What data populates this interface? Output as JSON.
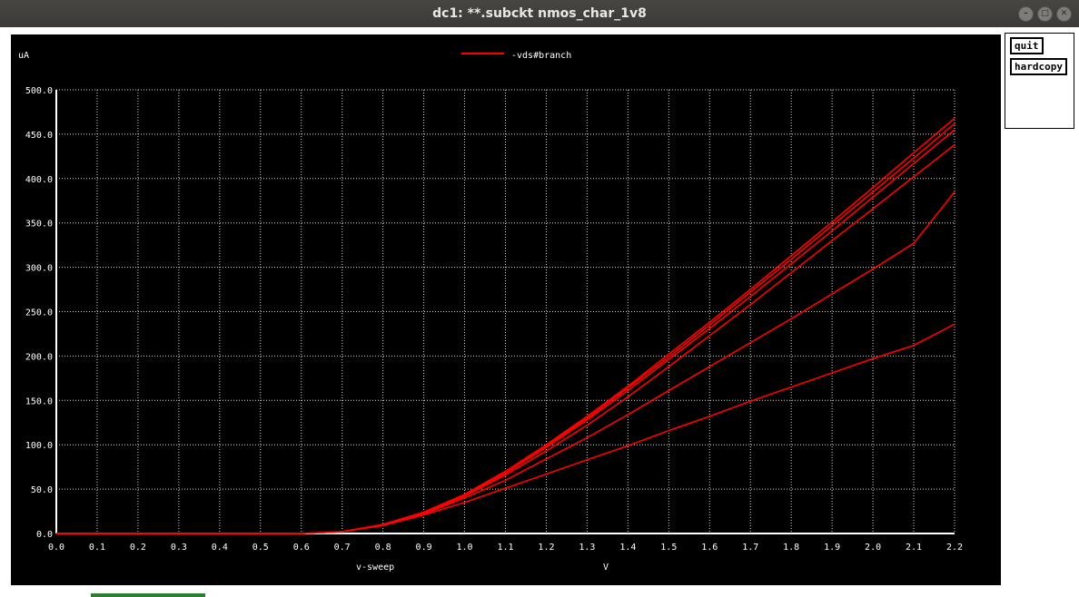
{
  "window": {
    "title": "dc1: **.subckt nmos_char_1v8"
  },
  "buttons": {
    "quit": "quit",
    "hardcopy": "hardcopy"
  },
  "colors": {
    "background": "#000000",
    "grid": "#ffffff",
    "trace": "#ff0000"
  },
  "chart_data": {
    "type": "line",
    "title": "",
    "ylabel": "uA",
    "xlabel": "v-sweep",
    "xunit": "V",
    "legend": [
      "-vds#branch"
    ],
    "legend_position": "top-center",
    "grid": true,
    "xlim": [
      0.0,
      2.2
    ],
    "ylim": [
      0.0,
      500.0
    ],
    "x_ticks": [
      "0.0",
      "0.1",
      "0.2",
      "0.3",
      "0.4",
      "0.5",
      "0.6",
      "0.7",
      "0.8",
      "0.9",
      "1.0",
      "1.1",
      "1.2",
      "1.3",
      "1.4",
      "1.5",
      "1.6",
      "1.7",
      "1.8",
      "1.9",
      "2.0",
      "2.1",
      "2.2"
    ],
    "y_ticks": [
      "0.0",
      "50.0",
      "100.0",
      "150.0",
      "200.0",
      "250.0",
      "300.0",
      "350.0",
      "400.0",
      "450.0",
      "500.0"
    ],
    "x": [
      0.0,
      0.6,
      0.7,
      0.8,
      0.9,
      1.0,
      1.1,
      1.2,
      1.3,
      1.4,
      1.5,
      1.6,
      1.7,
      1.8,
      1.9,
      2.0,
      2.1,
      2.2
    ],
    "series": [
      {
        "values": [
          0,
          0,
          2,
          10,
          24,
          44,
          70,
          100,
          132,
          166,
          202,
          238,
          275,
          313,
          351,
          390,
          429,
          468
        ]
      },
      {
        "values": [
          0,
          0,
          2,
          10,
          24,
          44,
          70,
          99,
          130,
          164,
          199,
          235,
          272,
          309,
          347,
          385,
          423,
          462
        ]
      },
      {
        "values": [
          0,
          0,
          2,
          10,
          24,
          43,
          68,
          97,
          128,
          161,
          196,
          231,
          267,
          304,
          341,
          379,
          417,
          455
        ]
      },
      {
        "values": [
          0,
          0,
          2,
          10,
          23,
          42,
          66,
          93,
          122,
          154,
          188,
          223,
          258,
          294,
          330,
          366,
          402,
          438
        ]
      },
      {
        "values": [
          0,
          0,
          2,
          9,
          22,
          40,
          60,
          84,
          108,
          134,
          161,
          188,
          215,
          242,
          270,
          298,
          327,
          385
        ]
      },
      {
        "values": [
          0,
          0,
          2,
          9,
          21,
          35,
          51,
          67,
          83,
          99,
          116,
          132,
          149,
          165,
          181,
          197,
          212,
          236
        ]
      }
    ]
  }
}
